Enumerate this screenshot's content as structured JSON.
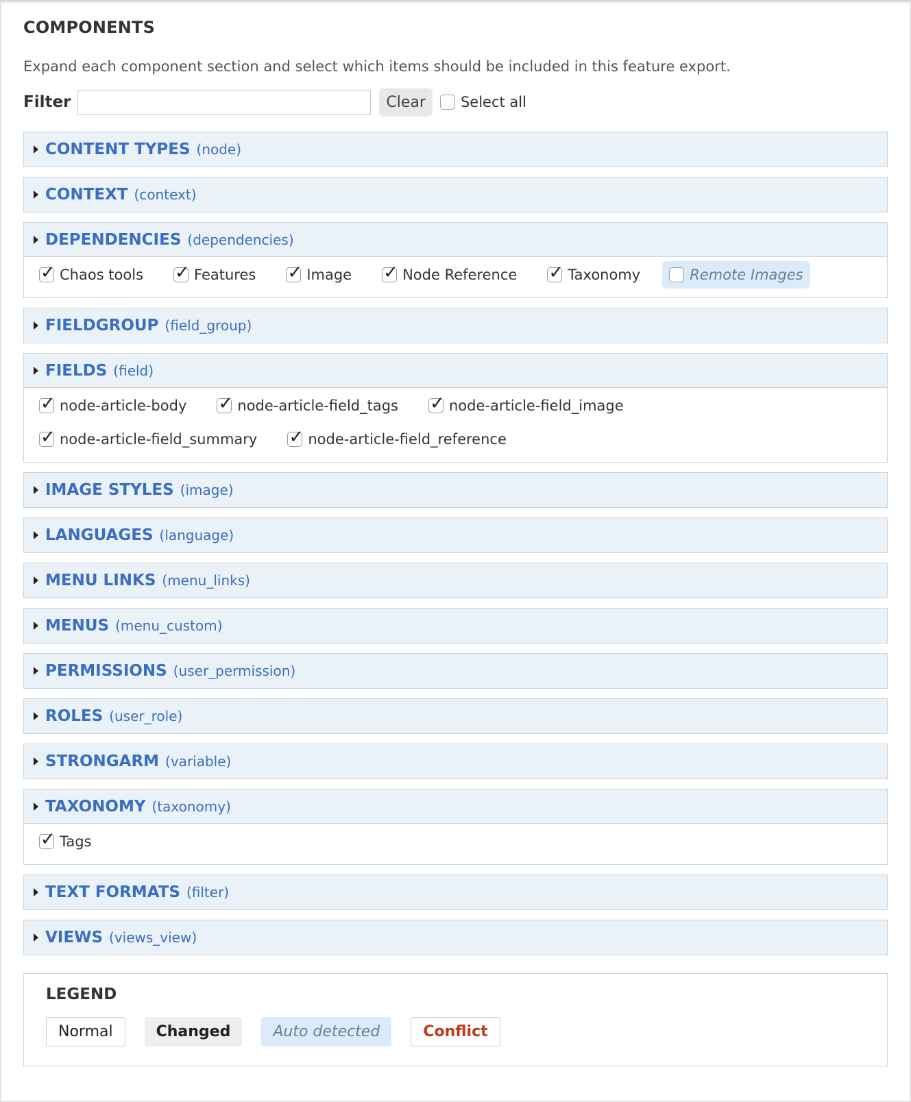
{
  "header": {
    "title": "COMPONENTS",
    "description": "Expand each component section and select which items should be included in this feature export."
  },
  "filter": {
    "label": "Filter",
    "value": "",
    "clear_label": "Clear",
    "select_all_label": "Select all",
    "select_all_checked": false
  },
  "sections": [
    {
      "name": "CONTENT TYPES",
      "machine": "(node)",
      "items": []
    },
    {
      "name": "CONTEXT",
      "machine": "(context)",
      "items": []
    },
    {
      "name": "DEPENDENCIES",
      "machine": "(dependencies)",
      "items": [
        {
          "label": "Chaos tools",
          "checked": true,
          "state": "normal"
        },
        {
          "label": "Features",
          "checked": true,
          "state": "normal"
        },
        {
          "label": "Image",
          "checked": true,
          "state": "normal"
        },
        {
          "label": "Node Reference",
          "checked": true,
          "state": "normal"
        },
        {
          "label": "Taxonomy",
          "checked": true,
          "state": "normal"
        },
        {
          "label": "Remote Images",
          "checked": false,
          "state": "auto"
        }
      ]
    },
    {
      "name": "FIELDGROUP",
      "machine": "(field_group)",
      "items": []
    },
    {
      "name": "FIELDS",
      "machine": "(field)",
      "items": [
        {
          "label": "node-article-body",
          "checked": true,
          "state": "normal"
        },
        {
          "label": "node-article-field_tags",
          "checked": true,
          "state": "normal"
        },
        {
          "label": "node-article-field_image",
          "checked": true,
          "state": "normal"
        },
        {
          "label": "node-article-field_summary",
          "checked": true,
          "state": "normal"
        },
        {
          "label": "node-article-field_reference",
          "checked": true,
          "state": "normal"
        }
      ]
    },
    {
      "name": "IMAGE STYLES",
      "machine": "(image)",
      "items": []
    },
    {
      "name": "LANGUAGES",
      "machine": "(language)",
      "items": []
    },
    {
      "name": "MENU LINKS",
      "machine": "(menu_links)",
      "items": []
    },
    {
      "name": "MENUS",
      "machine": "(menu_custom)",
      "items": []
    },
    {
      "name": "PERMISSIONS",
      "machine": "(user_permission)",
      "items": []
    },
    {
      "name": "ROLES",
      "machine": "(user_role)",
      "items": []
    },
    {
      "name": "STRONGARM",
      "machine": "(variable)",
      "items": []
    },
    {
      "name": "TAXONOMY",
      "machine": "(taxonomy)",
      "items": [
        {
          "label": "Tags",
          "checked": true,
          "state": "normal"
        }
      ]
    },
    {
      "name": "TEXT FORMATS",
      "machine": "(filter)",
      "items": []
    },
    {
      "name": "VIEWS",
      "machine": "(views_view)",
      "items": []
    }
  ],
  "legend": {
    "title": "LEGEND",
    "normal": "Normal",
    "changed": "Changed",
    "auto": "Auto detected",
    "conflict": "Conflict"
  },
  "colors": {
    "link": "#3a6ec2",
    "section_header_bg": "#eaf2f8",
    "auto_bg": "#dcebf9",
    "conflict": "#c0391b"
  }
}
